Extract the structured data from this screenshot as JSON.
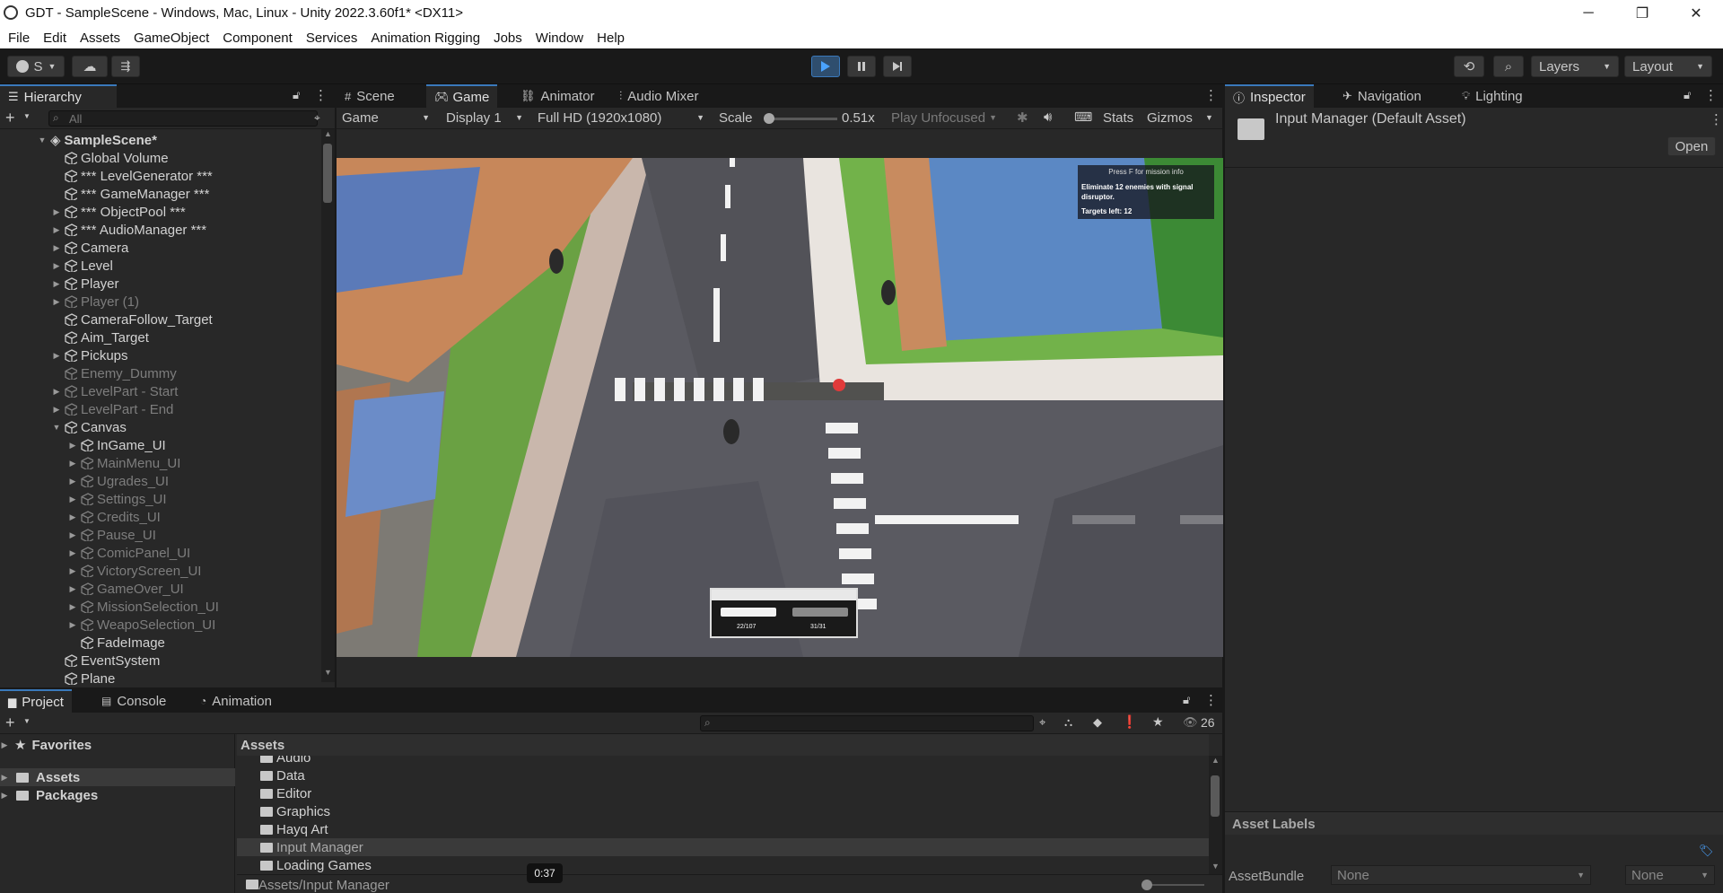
{
  "window": {
    "title": "GDT - SampleScene - Windows, Mac, Linux - Unity 2022.3.60f1* <DX11>",
    "controls": [
      "─",
      "❐",
      "✕"
    ]
  },
  "menu": [
    "File",
    "Edit",
    "Assets",
    "GameObject",
    "Component",
    "Services",
    "Animation Rigging",
    "Jobs",
    "Window",
    "Help"
  ],
  "toolbar": {
    "account": "S",
    "layers": "Layers",
    "layout": "Layout"
  },
  "hierarchy": {
    "tab": "Hierarchy",
    "search_placeholder": "All",
    "scene": "SampleScene*",
    "items": [
      {
        "label": "Global Volume",
        "indent": 1,
        "arrow": false,
        "dim": false
      },
      {
        "label": "*** LevelGenerator ***",
        "indent": 1,
        "arrow": false,
        "dim": false
      },
      {
        "label": "*** GameManager ***",
        "indent": 1,
        "arrow": false,
        "dim": false
      },
      {
        "label": "*** ObjectPool ***",
        "indent": 1,
        "arrow": true,
        "dim": false
      },
      {
        "label": "*** AudioManager ***",
        "indent": 1,
        "arrow": true,
        "dim": false
      },
      {
        "label": "Camera",
        "indent": 1,
        "arrow": true,
        "dim": false
      },
      {
        "label": "Level",
        "indent": 1,
        "arrow": true,
        "dim": false
      },
      {
        "label": "Player",
        "indent": 1,
        "arrow": true,
        "dim": false
      },
      {
        "label": "Player (1)",
        "indent": 1,
        "arrow": true,
        "dim": true
      },
      {
        "label": "CameraFollow_Target",
        "indent": 1,
        "arrow": false,
        "dim": false
      },
      {
        "label": "Aim_Target",
        "indent": 1,
        "arrow": false,
        "dim": false
      },
      {
        "label": "Pickups",
        "indent": 1,
        "arrow": true,
        "dim": false
      },
      {
        "label": "Enemy_Dummy",
        "indent": 1,
        "arrow": false,
        "dim": true
      },
      {
        "label": "LevelPart - Start",
        "indent": 1,
        "arrow": true,
        "dim": true
      },
      {
        "label": "LevelPart - End",
        "indent": 1,
        "arrow": true,
        "dim": true
      },
      {
        "label": "Canvas",
        "indent": 1,
        "arrow": true,
        "open": true,
        "dim": false
      },
      {
        "label": "InGame_UI",
        "indent": 2,
        "arrow": true,
        "dim": false
      },
      {
        "label": "MainMenu_UI",
        "indent": 2,
        "arrow": true,
        "dim": true
      },
      {
        "label": "Ugrades_UI",
        "indent": 2,
        "arrow": true,
        "dim": true
      },
      {
        "label": "Settings_UI",
        "indent": 2,
        "arrow": true,
        "dim": true
      },
      {
        "label": "Credits_UI",
        "indent": 2,
        "arrow": true,
        "dim": true
      },
      {
        "label": "Pause_UI",
        "indent": 2,
        "arrow": true,
        "dim": true
      },
      {
        "label": "ComicPanel_UI",
        "indent": 2,
        "arrow": true,
        "dim": true
      },
      {
        "label": "VictoryScreen_UI",
        "indent": 2,
        "arrow": true,
        "dim": true
      },
      {
        "label": "GameOver_UI",
        "indent": 2,
        "arrow": true,
        "dim": true
      },
      {
        "label": "MissionSelection_UI",
        "indent": 2,
        "arrow": true,
        "dim": true
      },
      {
        "label": "WeapoSelection_UI",
        "indent": 2,
        "arrow": true,
        "dim": true
      },
      {
        "label": "FadeImage",
        "indent": 2,
        "arrow": false,
        "dim": false
      },
      {
        "label": "EventSystem",
        "indent": 1,
        "arrow": false,
        "dim": false
      },
      {
        "label": "Plane",
        "indent": 1,
        "arrow": false,
        "dim": false
      }
    ]
  },
  "center_tabs": [
    "Scene",
    "Game",
    "Animator",
    "Audio Mixer"
  ],
  "game_bar": {
    "view": "Game",
    "display": "Display 1",
    "resolution": "Full HD (1920x1080)",
    "scale_label": "Scale",
    "scale_value": "0.51x",
    "play_mode": "Play Unfocused",
    "stats": "Stats",
    "gizmos": "Gizmos"
  },
  "game_hud": {
    "mission_header": "Press F for mission info",
    "mission_text": "Eliminate 12 enemies with signal disruptor.",
    "targets": "Targets left: 12",
    "ammo_primary": "22/107",
    "ammo_secondary": "31/31"
  },
  "inspector": {
    "tabs": [
      "Inspector",
      "Navigation",
      "Lighting"
    ],
    "title": "Input Manager (Default Asset)",
    "open_button": "Open",
    "asset_labels": "Asset Labels",
    "assetbundle_label": "AssetBundle",
    "assetbundle_value": "None",
    "variant_value": "None"
  },
  "bottom_tabs": [
    "Project",
    "Console",
    "Animation"
  ],
  "project": {
    "hidden_count": "26",
    "favorites": "Favorites",
    "tree": [
      "Assets",
      "Packages"
    ],
    "assets_header": "Assets",
    "folders": [
      "Audio",
      "Data",
      "Editor",
      "Graphics",
      "Hayq Art",
      "Input Manager",
      "Loading Games"
    ],
    "selected_folder": "Input Manager",
    "path": "Assets/Input Manager"
  },
  "video_overlay": {
    "timestamp": "0:37"
  },
  "colors": {
    "accent": "#3a79bb",
    "panel": "#282828",
    "bg": "#191919"
  }
}
